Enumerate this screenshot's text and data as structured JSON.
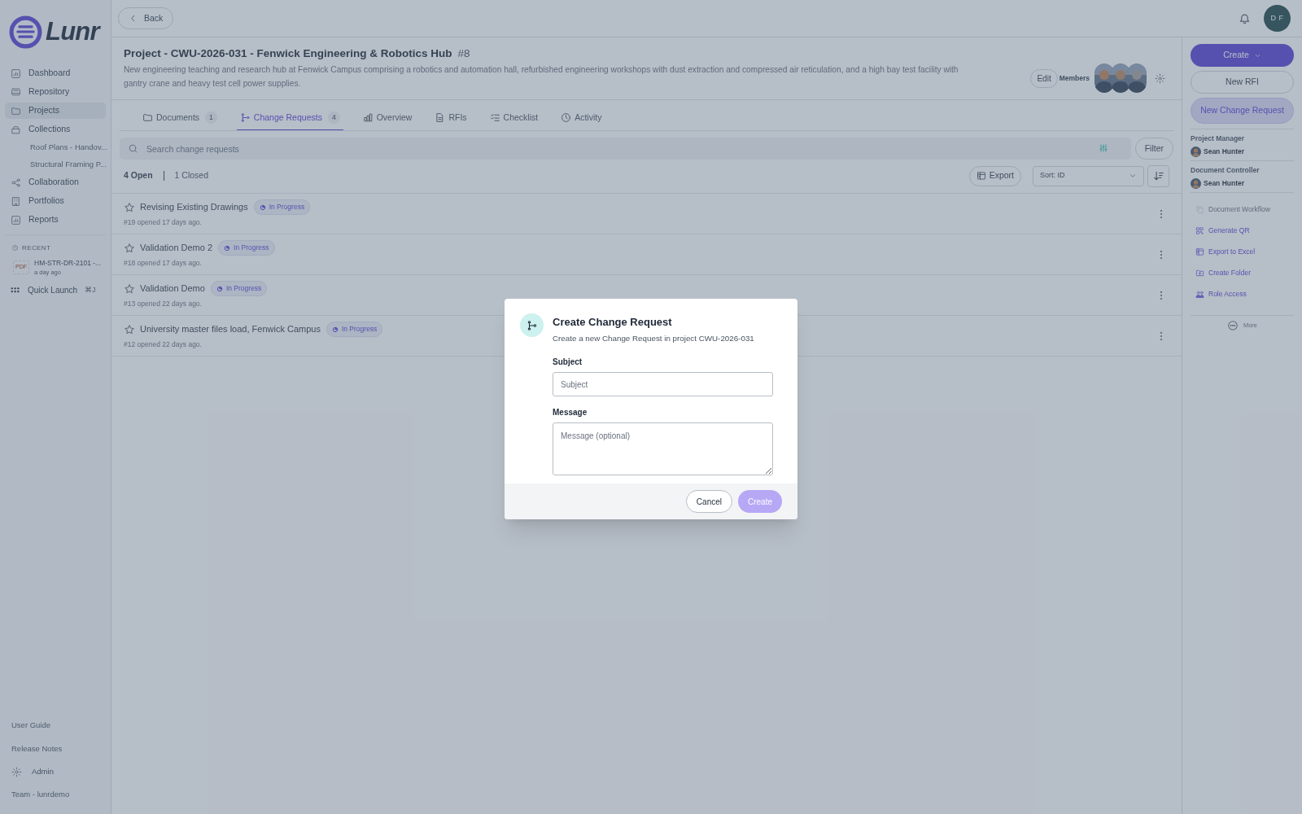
{
  "logo": {
    "text": "Lunr"
  },
  "sidebar": {
    "items": [
      {
        "label": "Dashboard",
        "selected": false
      },
      {
        "label": "Repository",
        "selected": false
      },
      {
        "label": "Projects",
        "selected": true
      },
      {
        "label": "Collections",
        "selected": false,
        "children": [
          {
            "label": "Roof Plans - Handov..."
          },
          {
            "label": "Structural Framing P..."
          }
        ]
      },
      {
        "label": "Collaboration",
        "selected": false
      },
      {
        "label": "Portfolios",
        "selected": false
      },
      {
        "label": "Reports",
        "selected": false
      }
    ],
    "recent": {
      "heading": "RECENT",
      "items": [
        {
          "badge": "PDF",
          "title": "HM-STR-DR-2101 -...",
          "time": "a day ago"
        }
      ]
    },
    "quick_launch": {
      "label": "Quick Launch",
      "shortcut": "⌘J"
    },
    "footer_links": [
      "User Guide",
      "Release Notes"
    ],
    "admin": "Admin",
    "team": "Team - lunrdemo"
  },
  "topbar": {
    "back": "Back",
    "user_initials": "D F"
  },
  "project": {
    "title": "Project - CWU-2026-031 - Fenwick Engineering & Robotics Hub",
    "number": "#8",
    "description": "New engineering teaching and research hub at Fenwick Campus comprising a robotics and automation hall, refurbished engineering workshops with dust extraction and compressed air reticulation, and a high bay test facility with gantry crane and heavy test cell power supplies.",
    "edit": "Edit",
    "members_label": "Members"
  },
  "tabs": [
    {
      "label": "Documents",
      "count": "1",
      "selected": false
    },
    {
      "label": "Change Requests",
      "count": "4",
      "selected": true
    },
    {
      "label": "Overview",
      "selected": false
    },
    {
      "label": "RFIs",
      "selected": false
    },
    {
      "label": "Checklist",
      "selected": false
    },
    {
      "label": "Activity",
      "selected": false
    }
  ],
  "search": {
    "placeholder": "Search change requests"
  },
  "filter": "Filter",
  "open_count": "4 Open",
  "closed_count": "1 Closed",
  "export": "Export",
  "sort": "Sort: ID",
  "requests": [
    {
      "title": "Revising Existing Drawings",
      "status": "In Progress",
      "meta": "#19 opened 17 days ago."
    },
    {
      "title": "Validation Demo 2",
      "status": "In Progress",
      "meta": "#18 opened 17 days ago."
    },
    {
      "title": "Validation Demo",
      "status": "In Progress",
      "meta": "#13 opened 22 days ago."
    },
    {
      "title": "University master files load, Fenwick Campus",
      "status": "In Progress",
      "meta": "#12 opened 22 days ago."
    }
  ],
  "right_panel": {
    "create": "Create",
    "new_rfi": "New RFI",
    "new_change_request": "New Change Request",
    "roles": [
      {
        "label": "Project Manager",
        "person": "Sean Hunter"
      },
      {
        "label": "Document Controller",
        "person": "Sean Hunter"
      }
    ],
    "actions": [
      {
        "label": "Document Workflow",
        "disabled": true
      },
      {
        "label": "Generate QR",
        "disabled": false
      },
      {
        "label": "Export to Excel",
        "disabled": false
      },
      {
        "label": "Create Folder",
        "disabled": false
      },
      {
        "label": "Role Access",
        "disabled": false
      }
    ],
    "more": "More"
  },
  "modal": {
    "title": "Create Change Request",
    "subtitle": "Create a new Change Request in project CWU-2026-031",
    "subject_label": "Subject",
    "subject_placeholder": "Subject",
    "message_label": "Message",
    "message_placeholder": "Message (optional)",
    "cancel": "Cancel",
    "create": "Create",
    "create_disabled": true
  }
}
